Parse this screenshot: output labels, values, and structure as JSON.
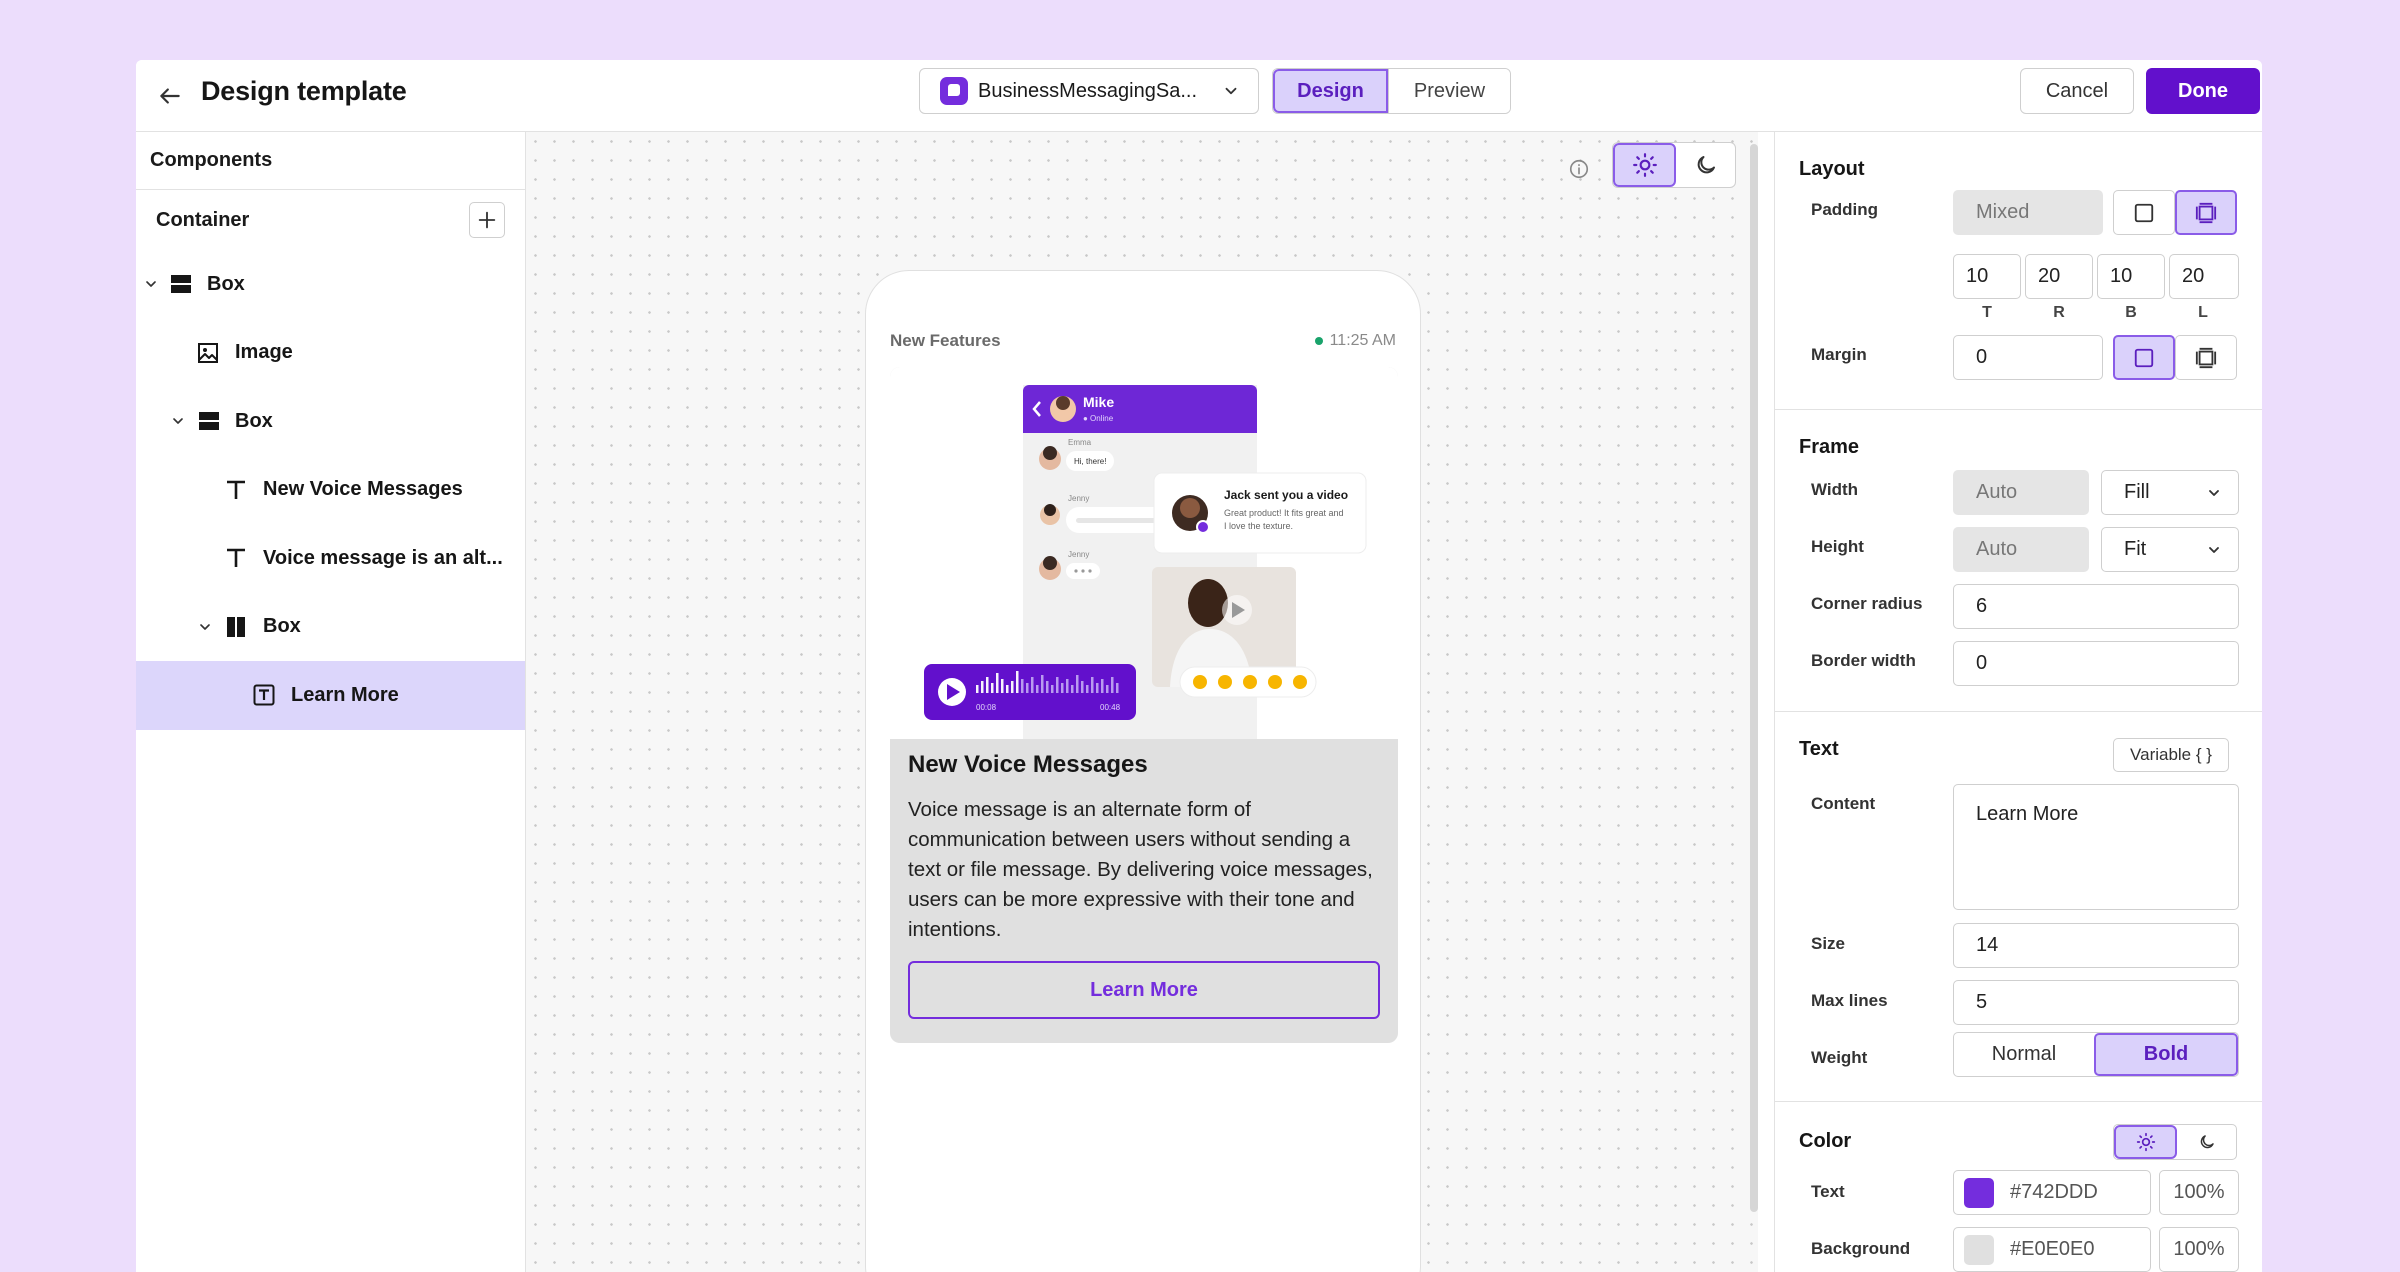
{
  "header": {
    "title": "Design template",
    "channel_name": "BusinessMessagingSa...",
    "tabs": {
      "design": "Design",
      "preview": "Preview"
    },
    "cancel_label": "Cancel",
    "done_label": "Done"
  },
  "left_panel": {
    "title": "Components",
    "container_label": "Container",
    "tree": [
      {
        "label": "Box",
        "icon": "box-rows-icon",
        "expanded": true
      },
      {
        "label": "Image",
        "icon": "image-icon"
      },
      {
        "label": "Box",
        "icon": "box-rows-icon",
        "expanded": true
      },
      {
        "label": "New Voice Messages",
        "icon": "text-icon"
      },
      {
        "label": "Voice message is an alt...",
        "icon": "text-icon"
      },
      {
        "label": "Box",
        "icon": "box-columns-icon",
        "expanded": true
      },
      {
        "label": "Learn More",
        "icon": "text-button-icon",
        "selected": true
      }
    ]
  },
  "canvas": {
    "message": {
      "sender": "New Features",
      "time": "11:25 AM",
      "image": {
        "chat_user": "Mike",
        "chat_status": "● Online",
        "contact_1": "Emma",
        "greeting": "Hi, there!",
        "contact_2": "Jenny",
        "contact_3": "Jenny",
        "notification_title": "Jack sent you a video",
        "notification_body_1": "Great product! It fits great and",
        "notification_body_2": "I love the texture.",
        "voice_start": "00:08",
        "voice_end": "00:48"
      },
      "title": "New Voice Messages",
      "description": "Voice message is an alternate form of communication between users without sending a text or file message. By delivering voice messages, users can be more expressive with their tone and intentions.",
      "button_label": "Learn More"
    }
  },
  "right_panel": {
    "layout": {
      "heading": "Layout",
      "padding_label": "Padding",
      "padding_value": "Mixed",
      "padding": {
        "t": "10",
        "r": "20",
        "b": "10",
        "l": "20"
      },
      "padding_caps": {
        "t": "T",
        "r": "R",
        "b": "B",
        "l": "L"
      },
      "margin_label": "Margin",
      "margin_value": "0"
    },
    "frame": {
      "heading": "Frame",
      "width_label": "Width",
      "width_value": "Auto",
      "width_mode": "Fill",
      "height_label": "Height",
      "height_value": "Auto",
      "height_mode": "Fit",
      "corner_radius_label": "Corner radius",
      "corner_radius_value": "6",
      "border_width_label": "Border width",
      "border_width_value": "0"
    },
    "text": {
      "heading": "Text",
      "variable_label": "Variable { }",
      "content_label": "Content",
      "content_value": "Learn More",
      "size_label": "Size",
      "size_value": "14",
      "max_lines_label": "Max lines",
      "max_lines_value": "5",
      "weight_label": "Weight",
      "weight_normal": "Normal",
      "weight_bold": "Bold"
    },
    "color": {
      "heading": "Color",
      "text_label": "Text",
      "text_hex": "#742DDD",
      "text_opacity": "100%",
      "background_label": "Background",
      "background_hex": "#E0E0E0",
      "background_opacity": "100%"
    }
  },
  "colors": {
    "accent": "#742DDD",
    "primary_button": "#6210CC",
    "selected_bg": "#DCD6FB",
    "page_bg": "#ECDDFC"
  }
}
